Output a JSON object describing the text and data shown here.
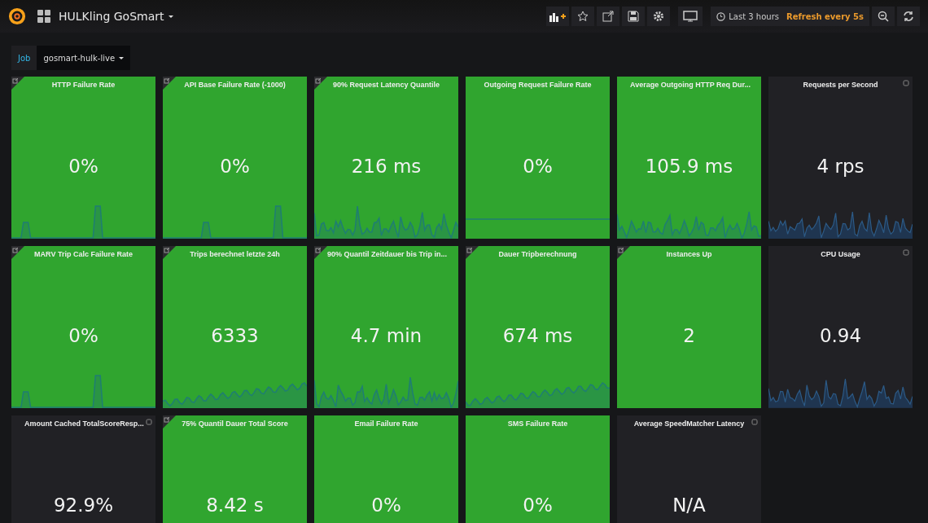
{
  "navbar": {
    "title": "HULKling GoSmart",
    "time_picker": {
      "range": "Last 3 hours",
      "refresh": "Refresh every 5s"
    }
  },
  "variables": [
    {
      "label": "Job",
      "value": "gosmart-hulk-live"
    }
  ],
  "panels": [
    {
      "title": "HTTP Failure Rate",
      "value": "0%",
      "healthy": true,
      "link": true,
      "kind": "spikes"
    },
    {
      "title": "API Base Failure Rate (-1000)",
      "value": "0%",
      "healthy": true,
      "link": true,
      "kind": "spikes"
    },
    {
      "title": "90% Request Latency Quantile",
      "value": "216 ms",
      "healthy": true,
      "link": true,
      "kind": "noisy"
    },
    {
      "title": "Outgoing Request Failure Rate",
      "value": "0%",
      "healthy": true,
      "link": false,
      "kind": "flat"
    },
    {
      "title": "Average Outgoing HTTP Req Dur...",
      "value": "105.9 ms",
      "healthy": true,
      "link": false,
      "kind": "noisy"
    },
    {
      "title": "Requests per Second",
      "value": "4 rps",
      "healthy": false,
      "link": false,
      "kind": "noisy"
    },
    {
      "title": "MARV Trip Calc Failure Rate",
      "value": "0%",
      "healthy": true,
      "link": true,
      "kind": "spikes"
    },
    {
      "title": "Trips berechnet letzte 24h",
      "value": "6333",
      "healthy": true,
      "link": true,
      "kind": "rising"
    },
    {
      "title": "90% Quantil Zeitdauer bis Trip in...",
      "value": "4.7 min",
      "healthy": true,
      "link": true,
      "kind": "noisy"
    },
    {
      "title": "Dauer Tripberechnung",
      "value": "674 ms",
      "healthy": true,
      "link": true,
      "kind": "rising"
    },
    {
      "title": "Instances Up",
      "value": "2",
      "healthy": true,
      "link": true,
      "kind": "plain"
    },
    {
      "title": "CPU Usage",
      "value": "0.94",
      "healthy": false,
      "link": false,
      "kind": "noisy"
    },
    {
      "title": "Amount Cached TotalScoreResp...",
      "value": "92.9%",
      "healthy": false,
      "link": false,
      "kind": "plain"
    },
    {
      "title": "75% Quantil Dauer Total Score",
      "value": "8.42 s",
      "healthy": true,
      "link": true,
      "kind": "plain"
    },
    {
      "title": "Email Failure Rate",
      "value": "0%",
      "healthy": true,
      "link": false,
      "kind": "plain"
    },
    {
      "title": "SMS Failure Rate",
      "value": "0%",
      "healthy": true,
      "link": false,
      "kind": "plain"
    },
    {
      "title": "Average SpeedMatcher Latency",
      "value": "N/A",
      "healthy": false,
      "link": false,
      "kind": "plain"
    }
  ]
}
